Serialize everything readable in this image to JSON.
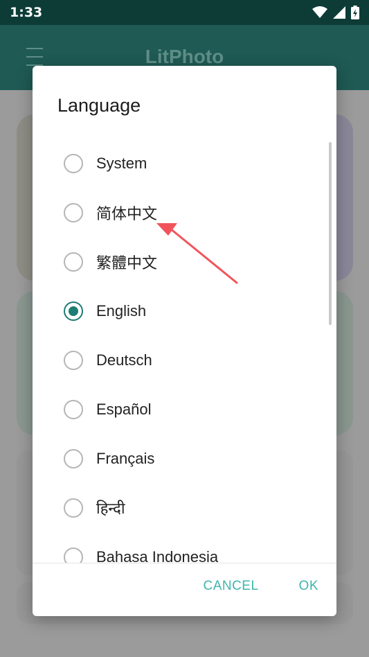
{
  "status_bar": {
    "time": "1:33",
    "icons": [
      "wifi-icon",
      "signal-icon",
      "battery-charging-icon"
    ]
  },
  "app_bar": {
    "title": "LitPhoto",
    "menu_icon": "menu-icon"
  },
  "dialog": {
    "title": "Language",
    "options": [
      {
        "label": "System",
        "selected": false
      },
      {
        "label": "简体中文",
        "selected": false
      },
      {
        "label": "繁體中文",
        "selected": false
      },
      {
        "label": "English",
        "selected": true
      },
      {
        "label": "Deutsch",
        "selected": false
      },
      {
        "label": "Español",
        "selected": false
      },
      {
        "label": "Français",
        "selected": false
      },
      {
        "label": "हिन्दी",
        "selected": false
      },
      {
        "label": "Bahasa Indonesia",
        "selected": false
      }
    ],
    "cancel_label": "CANCEL",
    "ok_label": "OK"
  },
  "colors": {
    "accent": "#1d7d74",
    "button_text": "#3fb5ad",
    "annotation_arrow": "#f0545a"
  }
}
